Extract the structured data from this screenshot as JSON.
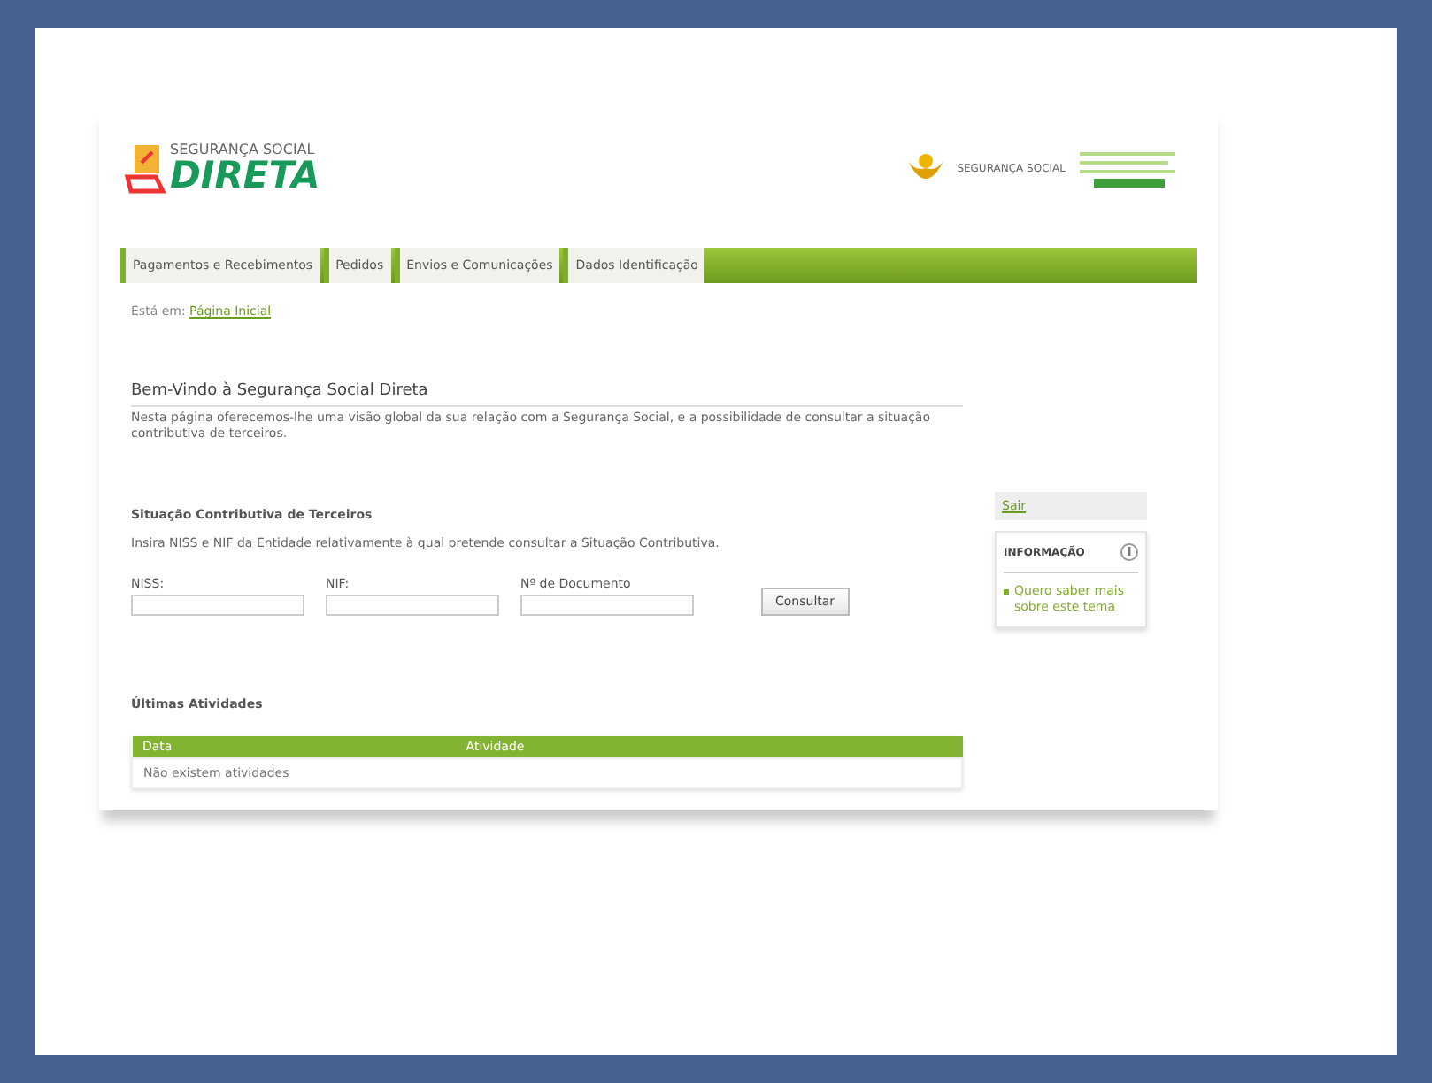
{
  "header": {
    "logo_top": "SEGURANÇA SOCIAL",
    "logo_main": "DIRETA",
    "partner": "SEGURANÇA SOCIAL"
  },
  "tabs": [
    {
      "label": "Pagamentos e Recebimentos",
      "selected": false
    },
    {
      "label": "Pedidos",
      "selected": false
    },
    {
      "label": "Envios e Comunicações",
      "selected": false
    },
    {
      "label": "Dados Identificação",
      "selected": false
    }
  ],
  "breadcrumb": {
    "prefix": "Está em:",
    "link": "Página Inicial"
  },
  "welcome": {
    "title": "Bem-Vindo à Segurança Social Direta",
    "text": "Nesta página oferecemos-lhe uma visão global da sua relação com a Segurança Social, e a possibilidade de consultar a situação contributiva de terceiros."
  },
  "third_party": {
    "title": "Situação Contributiva de Terceiros",
    "text": "Insira NISS e NIF da Entidade relativamente à qual pretende consultar a Situação Contributiva.",
    "fields": [
      {
        "label": "NISS:"
      },
      {
        "label": "NIF:"
      },
      {
        "label": "Nº de Documento"
      }
    ],
    "button": "Consultar"
  },
  "sidebar": {
    "logout": "Sair",
    "info_title": "INFORMAÇÃO",
    "info_link": "Quero saber mais sobre este tema"
  },
  "activities": {
    "title": "Últimas Atividades",
    "columns": [
      "Data",
      "Atividade"
    ],
    "empty": "Não existem atividades"
  }
}
